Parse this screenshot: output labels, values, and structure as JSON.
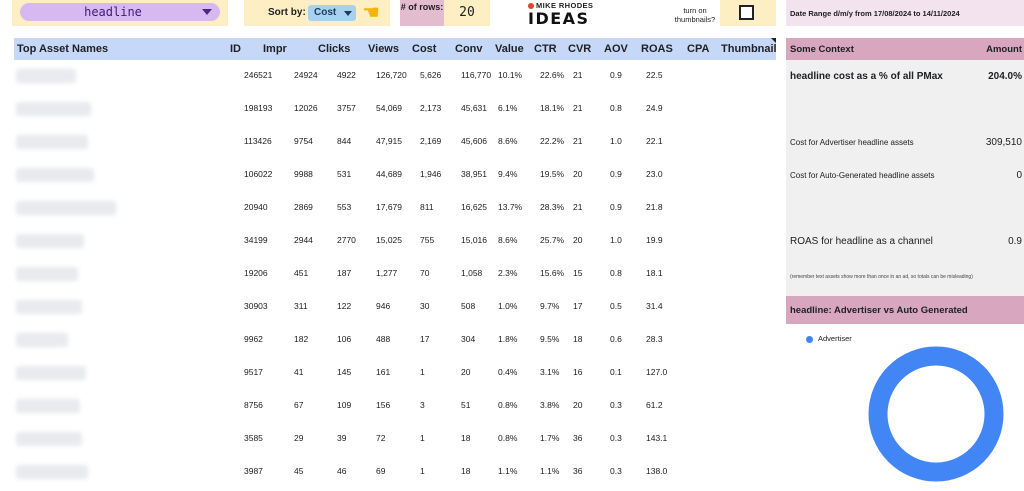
{
  "controls": {
    "asset_type": "headline",
    "sort_label": "Sort by:",
    "sort_value": "Cost",
    "rows_label": "# of rows:",
    "rows_value": "20",
    "thumbnails_label": "turn on thumbnails?",
    "thumbnails_checked": false
  },
  "logo": {
    "top": "MIKE RHODES",
    "main": "IDEAS",
    "dot_color": "#e8402a"
  },
  "date_range": "Date Range d/m/y from 17/08/2024 to 14/11/2024",
  "table": {
    "headers": [
      "Top Asset Names",
      "ID",
      "Impr",
      "Clicks",
      "Views",
      "Cost",
      "Conv",
      "Value",
      "CTR",
      "CVR",
      "AOV",
      "ROAS",
      "CPA",
      "Thumbnail"
    ],
    "rows": [
      [
        "246521",
        "24924",
        "4922",
        "126,720",
        "5,626",
        "116,770",
        "10.1%",
        "22.6%",
        "21",
        "0.9",
        "22.5"
      ],
      [
        "198193",
        "12026",
        "3757",
        "54,069",
        "2,173",
        "45,631",
        "6.1%",
        "18.1%",
        "21",
        "0.8",
        "24.9"
      ],
      [
        "113426",
        "9754",
        "844",
        "47,915",
        "2,169",
        "45,606",
        "8.6%",
        "22.2%",
        "21",
        "1.0",
        "22.1"
      ],
      [
        "106022",
        "9988",
        "531",
        "44,689",
        "1,946",
        "38,951",
        "9.4%",
        "19.5%",
        "20",
        "0.9",
        "23.0"
      ],
      [
        "20940",
        "2869",
        "553",
        "17,679",
        "811",
        "16,625",
        "13.7%",
        "28.3%",
        "21",
        "0.9",
        "21.8"
      ],
      [
        "34199",
        "2944",
        "2770",
        "15,025",
        "755",
        "15,016",
        "8.6%",
        "25.7%",
        "20",
        "1.0",
        "19.9"
      ],
      [
        "19206",
        "451",
        "187",
        "1,277",
        "70",
        "1,058",
        "2.3%",
        "15.6%",
        "15",
        "0.8",
        "18.1"
      ],
      [
        "30903",
        "311",
        "122",
        "946",
        "30",
        "508",
        "1.0%",
        "9.7%",
        "17",
        "0.5",
        "31.4"
      ],
      [
        "9962",
        "182",
        "106",
        "488",
        "17",
        "304",
        "1.8%",
        "9.5%",
        "18",
        "0.6",
        "28.3"
      ],
      [
        "9517",
        "41",
        "145",
        "161",
        "1",
        "20",
        "0.4%",
        "3.1%",
        "16",
        "0.1",
        "127.0"
      ],
      [
        "8756",
        "67",
        "109",
        "156",
        "3",
        "51",
        "0.8%",
        "3.8%",
        "20",
        "0.3",
        "61.2"
      ],
      [
        "3585",
        "29",
        "39",
        "72",
        "1",
        "18",
        "0.8%",
        "1.7%",
        "36",
        "0.3",
        "143.1"
      ],
      [
        "3987",
        "45",
        "46",
        "69",
        "1",
        "18",
        "1.1%",
        "1.1%",
        "36",
        "0.3",
        "138.0"
      ]
    ]
  },
  "context": {
    "header_left": "Some Context",
    "header_right": "Amount",
    "cost_pct_label": "headline cost as a % of all PMax",
    "cost_pct_value": "204.0%",
    "advertiser_cost_label": "Cost for Advertiser headline assets",
    "advertiser_cost_value": "309,510",
    "auto_cost_label": "Cost for Auto-Generated headline assets",
    "auto_cost_value": "0",
    "roas_label": "ROAS for headline as a channel",
    "roas_value": "0.9",
    "note": "(remember text assets show more than once in an ad, so totals can be misleading)"
  },
  "chart_data": {
    "type": "pie",
    "title": "headline: Advertiser vs Auto Generated",
    "donut": true,
    "legend_position": "top-left",
    "series": [
      {
        "name": "Advertiser",
        "value": 100,
        "color": "#4285f4"
      }
    ]
  }
}
